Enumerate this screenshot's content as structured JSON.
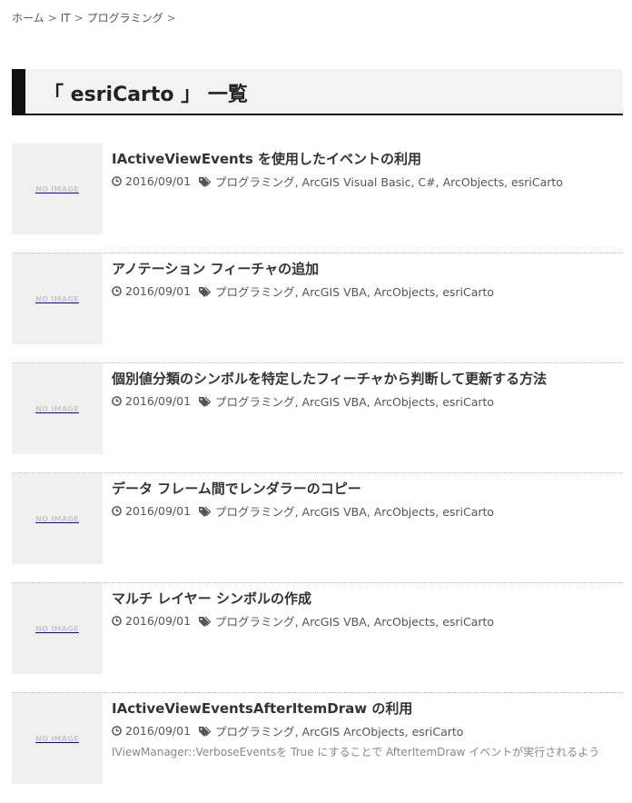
{
  "breadcrumb": {
    "items": [
      "ホーム",
      "IT",
      "プログラミング"
    ],
    "separator": ">"
  },
  "page_title": "「 esriCarto 」 一覧",
  "thumbnail_text": "NO IMAGE",
  "posts": [
    {
      "title": "IActiveViewEvents を使用したイベントの利用",
      "date": "2016/09/01",
      "tags": [
        "プログラミング",
        "ArcGIS Visual Basic",
        "C#",
        "ArcObjects",
        "esriCarto"
      ]
    },
    {
      "title": "アノテーション フィーチャの追加",
      "date": "2016/09/01",
      "tags": [
        "プログラミング",
        "ArcGIS VBA",
        "ArcObjects",
        "esriCarto"
      ]
    },
    {
      "title": "個別値分類のシンボルを特定したフィーチャから判断して更新する方法",
      "date": "2016/09/01",
      "tags": [
        "プログラミング",
        "ArcGIS VBA",
        "ArcObjects",
        "esriCarto"
      ]
    },
    {
      "title": "データ フレーム間でレンダラーのコピー",
      "date": "2016/09/01",
      "tags": [
        "プログラミング",
        "ArcGIS VBA",
        "ArcObjects",
        "esriCarto"
      ]
    },
    {
      "title": "マルチ レイヤー シンボルの作成",
      "date": "2016/09/01",
      "tags": [
        "プログラミング",
        "ArcGIS VBA",
        "ArcObjects",
        "esriCarto"
      ]
    },
    {
      "title": "IActiveViewEventsAfterItemDraw の利用",
      "date": "2016/09/01",
      "tags": [
        "プログラミング",
        "ArcGIS ArcObjects",
        "esriCarto"
      ],
      "excerpt": "IViewManager::VerboseEventsを True にすることで AfterItemDraw イベントが実行されるよう"
    }
  ]
}
